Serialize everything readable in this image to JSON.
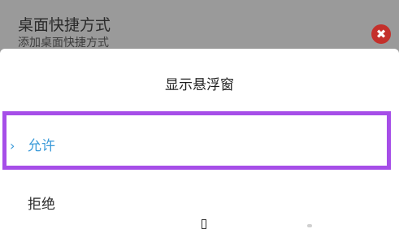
{
  "background_setting": {
    "title": "桌面快捷方式",
    "subtitle": "添加桌面快捷方式",
    "close_glyph": "✖"
  },
  "dialog": {
    "title": "显示悬浮窗",
    "options": [
      {
        "label": "允许",
        "selected": true,
        "indicator": "›"
      },
      {
        "label": "拒绝",
        "selected": false
      }
    ]
  },
  "colors": {
    "selected_text": "#3a9ad9",
    "highlight_border": "#a64ee8",
    "close_badge": "#c4302b",
    "dim_overlay": "#9a9a9a"
  }
}
